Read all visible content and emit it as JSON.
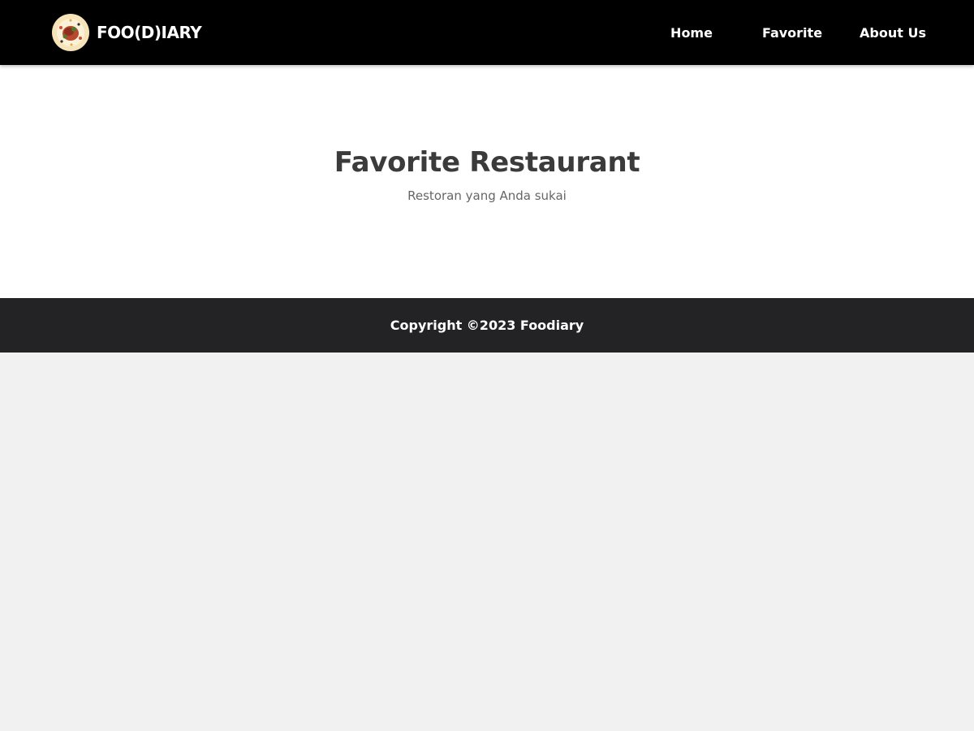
{
  "brand": {
    "name": "FOO(D)IARY",
    "logo_icon": "food-plate-icon"
  },
  "nav": {
    "items": [
      {
        "label": "Home"
      },
      {
        "label": "Favorite"
      },
      {
        "label": "About Us"
      }
    ]
  },
  "hero": {
    "title": "Favorite Restaurant",
    "subtitle": "Restoran yang Anda sukai"
  },
  "footer": {
    "copyright": "Copyright ©2023 Foodiary"
  },
  "colors": {
    "navbar_bg": "#000000",
    "hero_bg": "#ffffff",
    "footer_bg": "#232325",
    "page_bg": "#f1f1f1",
    "title_text": "#3b3b3b",
    "subtitle_text": "#666666"
  }
}
